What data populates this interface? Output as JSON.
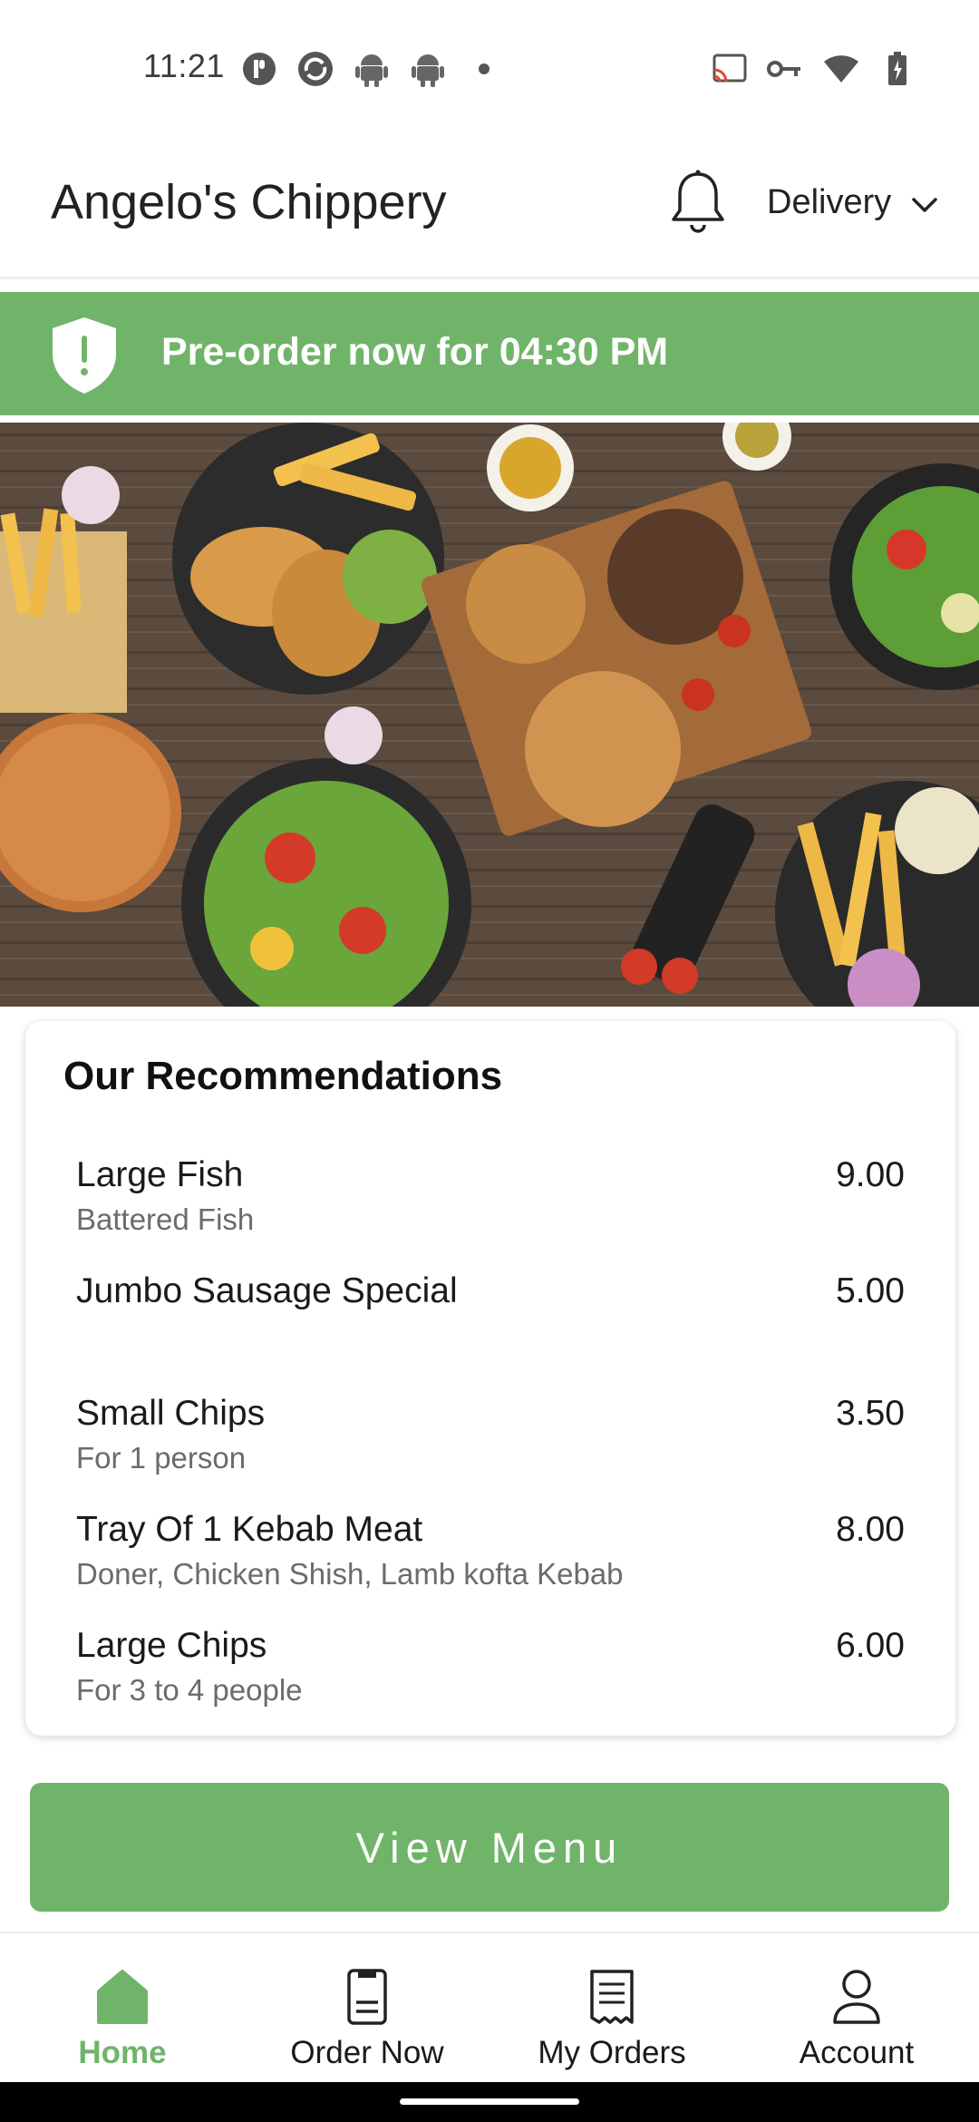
{
  "status_bar": {
    "time": "11:21"
  },
  "header": {
    "title": "Angelo's Chippery",
    "mode_selector": "Delivery"
  },
  "banner": {
    "text": "Pre-order now for 04:30 PM"
  },
  "recommendations": {
    "title": "Our Recommendations",
    "items": [
      {
        "name": "Large Fish",
        "description": "Battered Fish",
        "price": "9.00"
      },
      {
        "name": "Jumbo Sausage Special",
        "description": "",
        "price": "5.00"
      },
      {
        "name": "Small Chips",
        "description": "For 1 person",
        "price": "3.50"
      },
      {
        "name": "Tray Of 1 Kebab Meat",
        "description": "Doner, Chicken Shish, Lamb kofta Kebab",
        "price": "8.00"
      },
      {
        "name": "Large Chips",
        "description": "For 3 to 4 people",
        "price": "6.00"
      }
    ]
  },
  "view_menu_button": "View Menu",
  "bottom_nav": {
    "items": [
      {
        "label": "Home",
        "icon": "home-icon",
        "active": true
      },
      {
        "label": "Order Now",
        "icon": "order-icon",
        "active": false
      },
      {
        "label": "My Orders",
        "icon": "receipt-icon",
        "active": false
      },
      {
        "label": "Account",
        "icon": "person-icon",
        "active": false
      }
    ]
  },
  "colors": {
    "accent": "#70b46a",
    "text": "#1a1a1a",
    "muted": "#6b6b6b"
  }
}
